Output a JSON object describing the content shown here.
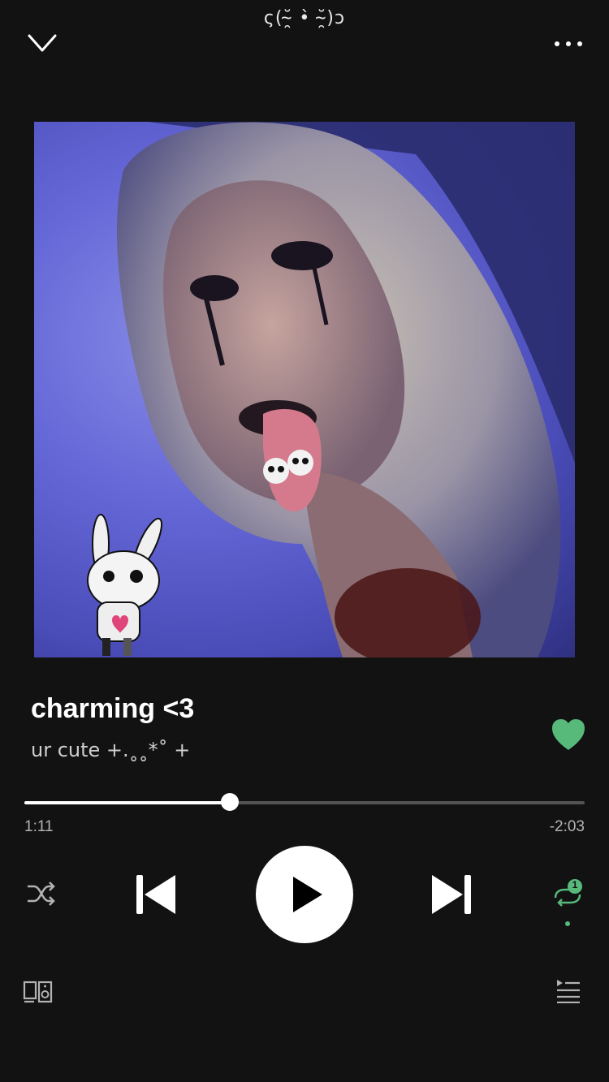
{
  "header": {
    "title": "ς(˘̴̯ •̀ ˘̴̯)ↄ",
    "collapse_icon": "chevron-down-icon",
    "more_icon": "more-horizontal-icon"
  },
  "track": {
    "title": "charming <3",
    "artist": "ur cute +.˳˳*˚ +",
    "liked": true
  },
  "playback": {
    "elapsed": "1:11",
    "remaining": "-2:03",
    "progress_fraction": 0.366,
    "state": "paused",
    "repeat_mode": "repeat-one",
    "repeat_badge": "1",
    "shuffle": false
  },
  "colors": {
    "background": "#121212",
    "accent": "#57b97a",
    "text_secondary": "#b3b3b3",
    "track_bg": "#535353"
  },
  "footer": {
    "devices_icon": "connect-devices-icon",
    "queue_icon": "queue-icon"
  }
}
